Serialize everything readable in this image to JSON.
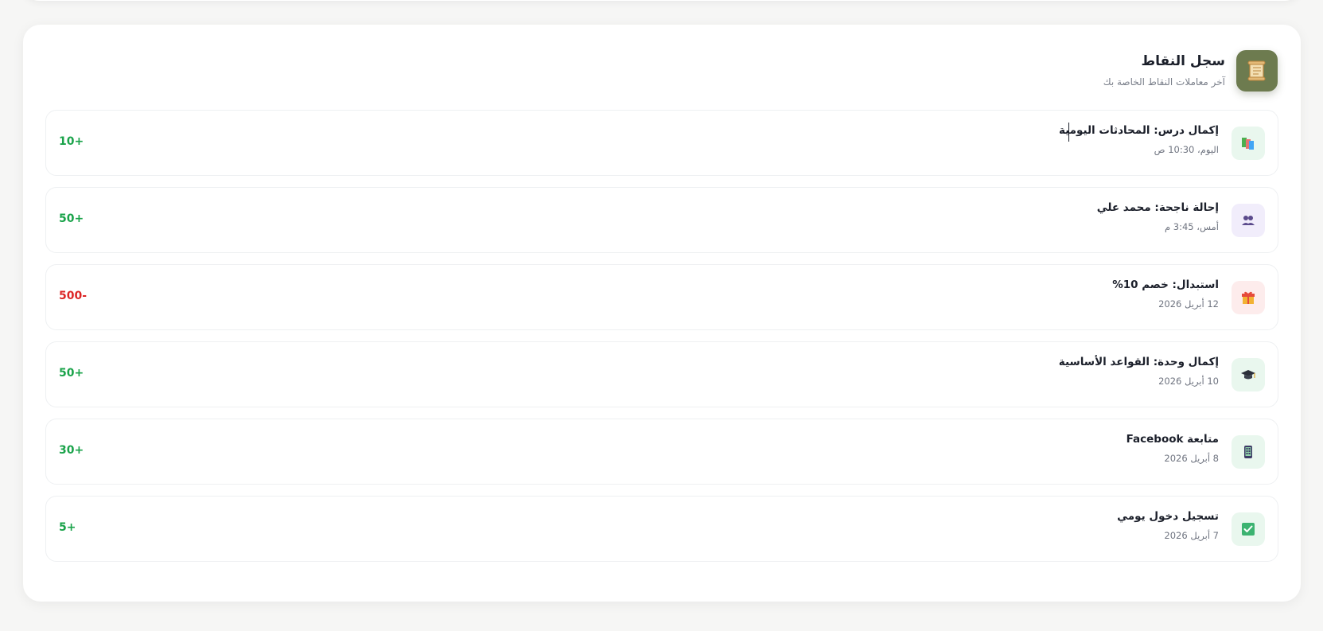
{
  "colors": {
    "positive": "#1aa34a",
    "negative": "#dc2626",
    "header_icon_bg": "#6d7b4f"
  },
  "header": {
    "title": "سجل النقاط",
    "subtitle": "آخر معاملات النقاط الخاصة بك",
    "icon": "scroll-icon"
  },
  "transactions": [
    {
      "title": "إكمال درس: المحادثات اليومية",
      "date": "اليوم، 10:30 ص",
      "points": "10+",
      "type": "positive",
      "icon": "books-icon",
      "icon_bg": "#e9f7ee"
    },
    {
      "title": "إحالة ناجحة: محمد علي",
      "date": "أمس، 3:45 م",
      "points": "50+",
      "type": "positive",
      "icon": "users-icon",
      "icon_bg": "#f1edfb"
    },
    {
      "title": "استبدال: خصم 10%",
      "date": "12 أبريل 2026",
      "points": "500-",
      "type": "negative",
      "icon": "gift-icon",
      "icon_bg": "#fdecec"
    },
    {
      "title": "إكمال وحدة: القواعد الأساسية",
      "date": "10 أبريل 2026",
      "points": "50+",
      "type": "positive",
      "icon": "graduation-cap-icon",
      "icon_bg": "#e9f7ee"
    },
    {
      "title": "متابعة Facebook",
      "date": "8 أبريل 2026",
      "points": "30+",
      "type": "positive",
      "icon": "mobile-phone-icon",
      "icon_bg": "#e9f7ee"
    },
    {
      "title": "تسجيل دخول يومي",
      "date": "7 أبريل 2026",
      "points": "5+",
      "type": "positive",
      "icon": "check-box-icon",
      "icon_bg": "#e9f7ee"
    }
  ]
}
